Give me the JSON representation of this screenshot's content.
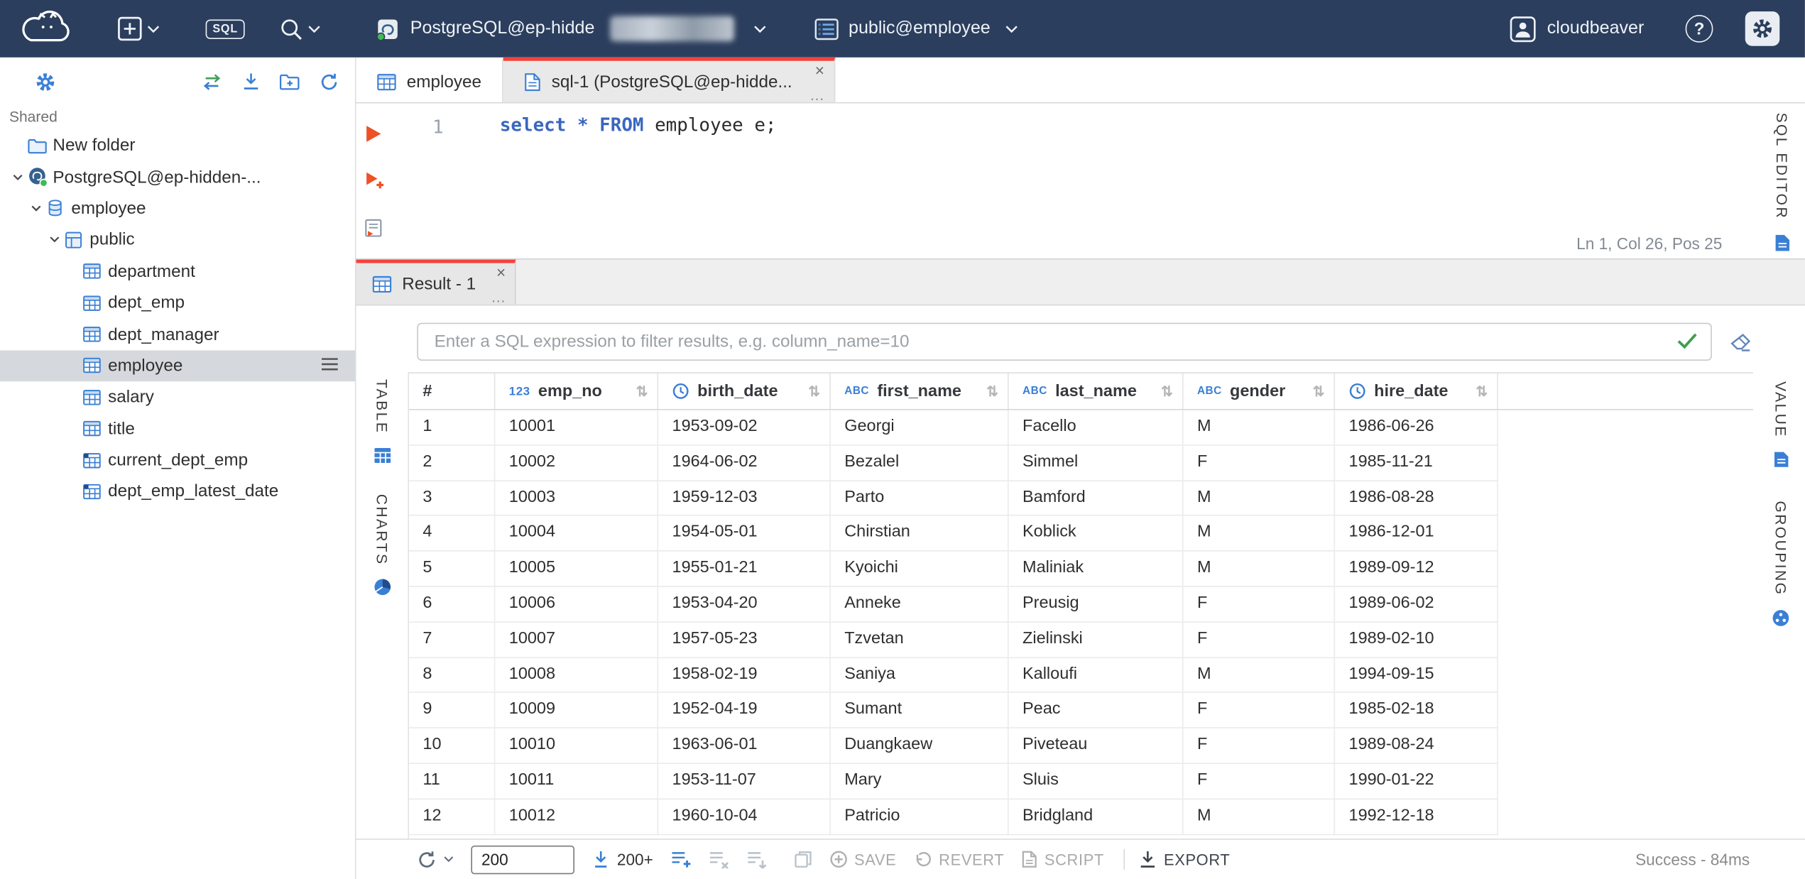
{
  "ui": {
    "ellipsis": "…",
    "close": "×"
  },
  "topbar": {
    "user_name": "cloudbeaver",
    "sql_button_label": "SQL",
    "connection_label": "PostgreSQL@ep-hidde",
    "schema_label": "public@employee"
  },
  "sidebar": {
    "section_label": "Shared",
    "tree": [
      {
        "label": "New folder",
        "indent": 0,
        "icon": "folder",
        "chevron": false
      },
      {
        "label": "PostgreSQL@ep-hidden-...",
        "indent": 0,
        "icon": "postgres",
        "chevron": true
      },
      {
        "label": "employee",
        "indent": 1,
        "icon": "database",
        "chevron": true
      },
      {
        "label": "public",
        "indent": 2,
        "icon": "schema",
        "chevron": true
      },
      {
        "label": "department",
        "indent": 3,
        "icon": "table",
        "chevron": false
      },
      {
        "label": "dept_emp",
        "indent": 3,
        "icon": "table",
        "chevron": false
      },
      {
        "label": "dept_manager",
        "indent": 3,
        "icon": "table",
        "chevron": false
      },
      {
        "label": "employee",
        "indent": 3,
        "icon": "table",
        "chevron": false,
        "selected": true
      },
      {
        "label": "salary",
        "indent": 3,
        "icon": "table",
        "chevron": false
      },
      {
        "label": "title",
        "indent": 3,
        "icon": "table",
        "chevron": false
      },
      {
        "label": "current_dept_emp",
        "indent": 3,
        "icon": "view",
        "chevron": false
      },
      {
        "label": "dept_emp_latest_date",
        "indent": 3,
        "icon": "view",
        "chevron": false
      }
    ]
  },
  "editor": {
    "tabs": [
      {
        "label": "employee"
      },
      {
        "label": "sql-1 (PostgreSQL@ep-hidde..."
      }
    ],
    "line_number": "1",
    "sql_tokens": [
      {
        "text": "select",
        "type": "keyword"
      },
      {
        "text": " ",
        "type": "plain"
      },
      {
        "text": "*",
        "type": "keyword"
      },
      {
        "text": " ",
        "type": "plain"
      },
      {
        "text": "FROM",
        "type": "keyword"
      },
      {
        "text": " employee e;",
        "type": "plain"
      }
    ],
    "caret_status": "Ln 1, Col 26, Pos 25",
    "side_tab_label": "SQL EDITOR"
  },
  "result": {
    "tab_label": "Result - 1",
    "filter_placeholder": "Enter a SQL expression to filter results, e.g. column_name=10",
    "left_tabs": [
      {
        "label": "TABLE"
      },
      {
        "label": "CHARTS"
      }
    ],
    "right_tabs": [
      {
        "label": "VALUE"
      },
      {
        "label": "GROUPING"
      }
    ],
    "type_icons": {
      "number": "123",
      "string": "ABC"
    },
    "toolbar": {
      "fetch_size_value": "200",
      "fetch_more_label": "200+",
      "save_label": "SAVE",
      "revert_label": "REVERT",
      "script_label": "SCRIPT",
      "export_label": "EXPORT",
      "status": "Success - 84ms"
    }
  },
  "chart_data": {
    "type": "table",
    "columns": [
      {
        "name": "#",
        "type": "rownum"
      },
      {
        "name": "emp_no",
        "type": "number"
      },
      {
        "name": "birth_date",
        "type": "date"
      },
      {
        "name": "first_name",
        "type": "string"
      },
      {
        "name": "last_name",
        "type": "string"
      },
      {
        "name": "gender",
        "type": "string"
      },
      {
        "name": "hire_date",
        "type": "date"
      }
    ],
    "rows": [
      [
        "1",
        "10001",
        "1953-09-02",
        "Georgi",
        "Facello",
        "M",
        "1986-06-26"
      ],
      [
        "2",
        "10002",
        "1964-06-02",
        "Bezalel",
        "Simmel",
        "F",
        "1985-11-21"
      ],
      [
        "3",
        "10003",
        "1959-12-03",
        "Parto",
        "Bamford",
        "M",
        "1986-08-28"
      ],
      [
        "4",
        "10004",
        "1954-05-01",
        "Chirstian",
        "Koblick",
        "M",
        "1986-12-01"
      ],
      [
        "5",
        "10005",
        "1955-01-21",
        "Kyoichi",
        "Maliniak",
        "M",
        "1989-09-12"
      ],
      [
        "6",
        "10006",
        "1953-04-20",
        "Anneke",
        "Preusig",
        "F",
        "1989-06-02"
      ],
      [
        "7",
        "10007",
        "1957-05-23",
        "Tzvetan",
        "Zielinski",
        "F",
        "1989-02-10"
      ],
      [
        "8",
        "10008",
        "1958-02-19",
        "Saniya",
        "Kalloufi",
        "M",
        "1994-09-15"
      ],
      [
        "9",
        "10009",
        "1952-04-19",
        "Sumant",
        "Peac",
        "F",
        "1985-02-18"
      ],
      [
        "10",
        "10010",
        "1963-06-01",
        "Duangkaew",
        "Piveteau",
        "F",
        "1989-08-24"
      ],
      [
        "11",
        "10011",
        "1953-11-07",
        "Mary",
        "Sluis",
        "F",
        "1990-01-22"
      ],
      [
        "12",
        "10012",
        "1960-10-04",
        "Patricio",
        "Bridgland",
        "M",
        "1992-12-18"
      ]
    ]
  }
}
